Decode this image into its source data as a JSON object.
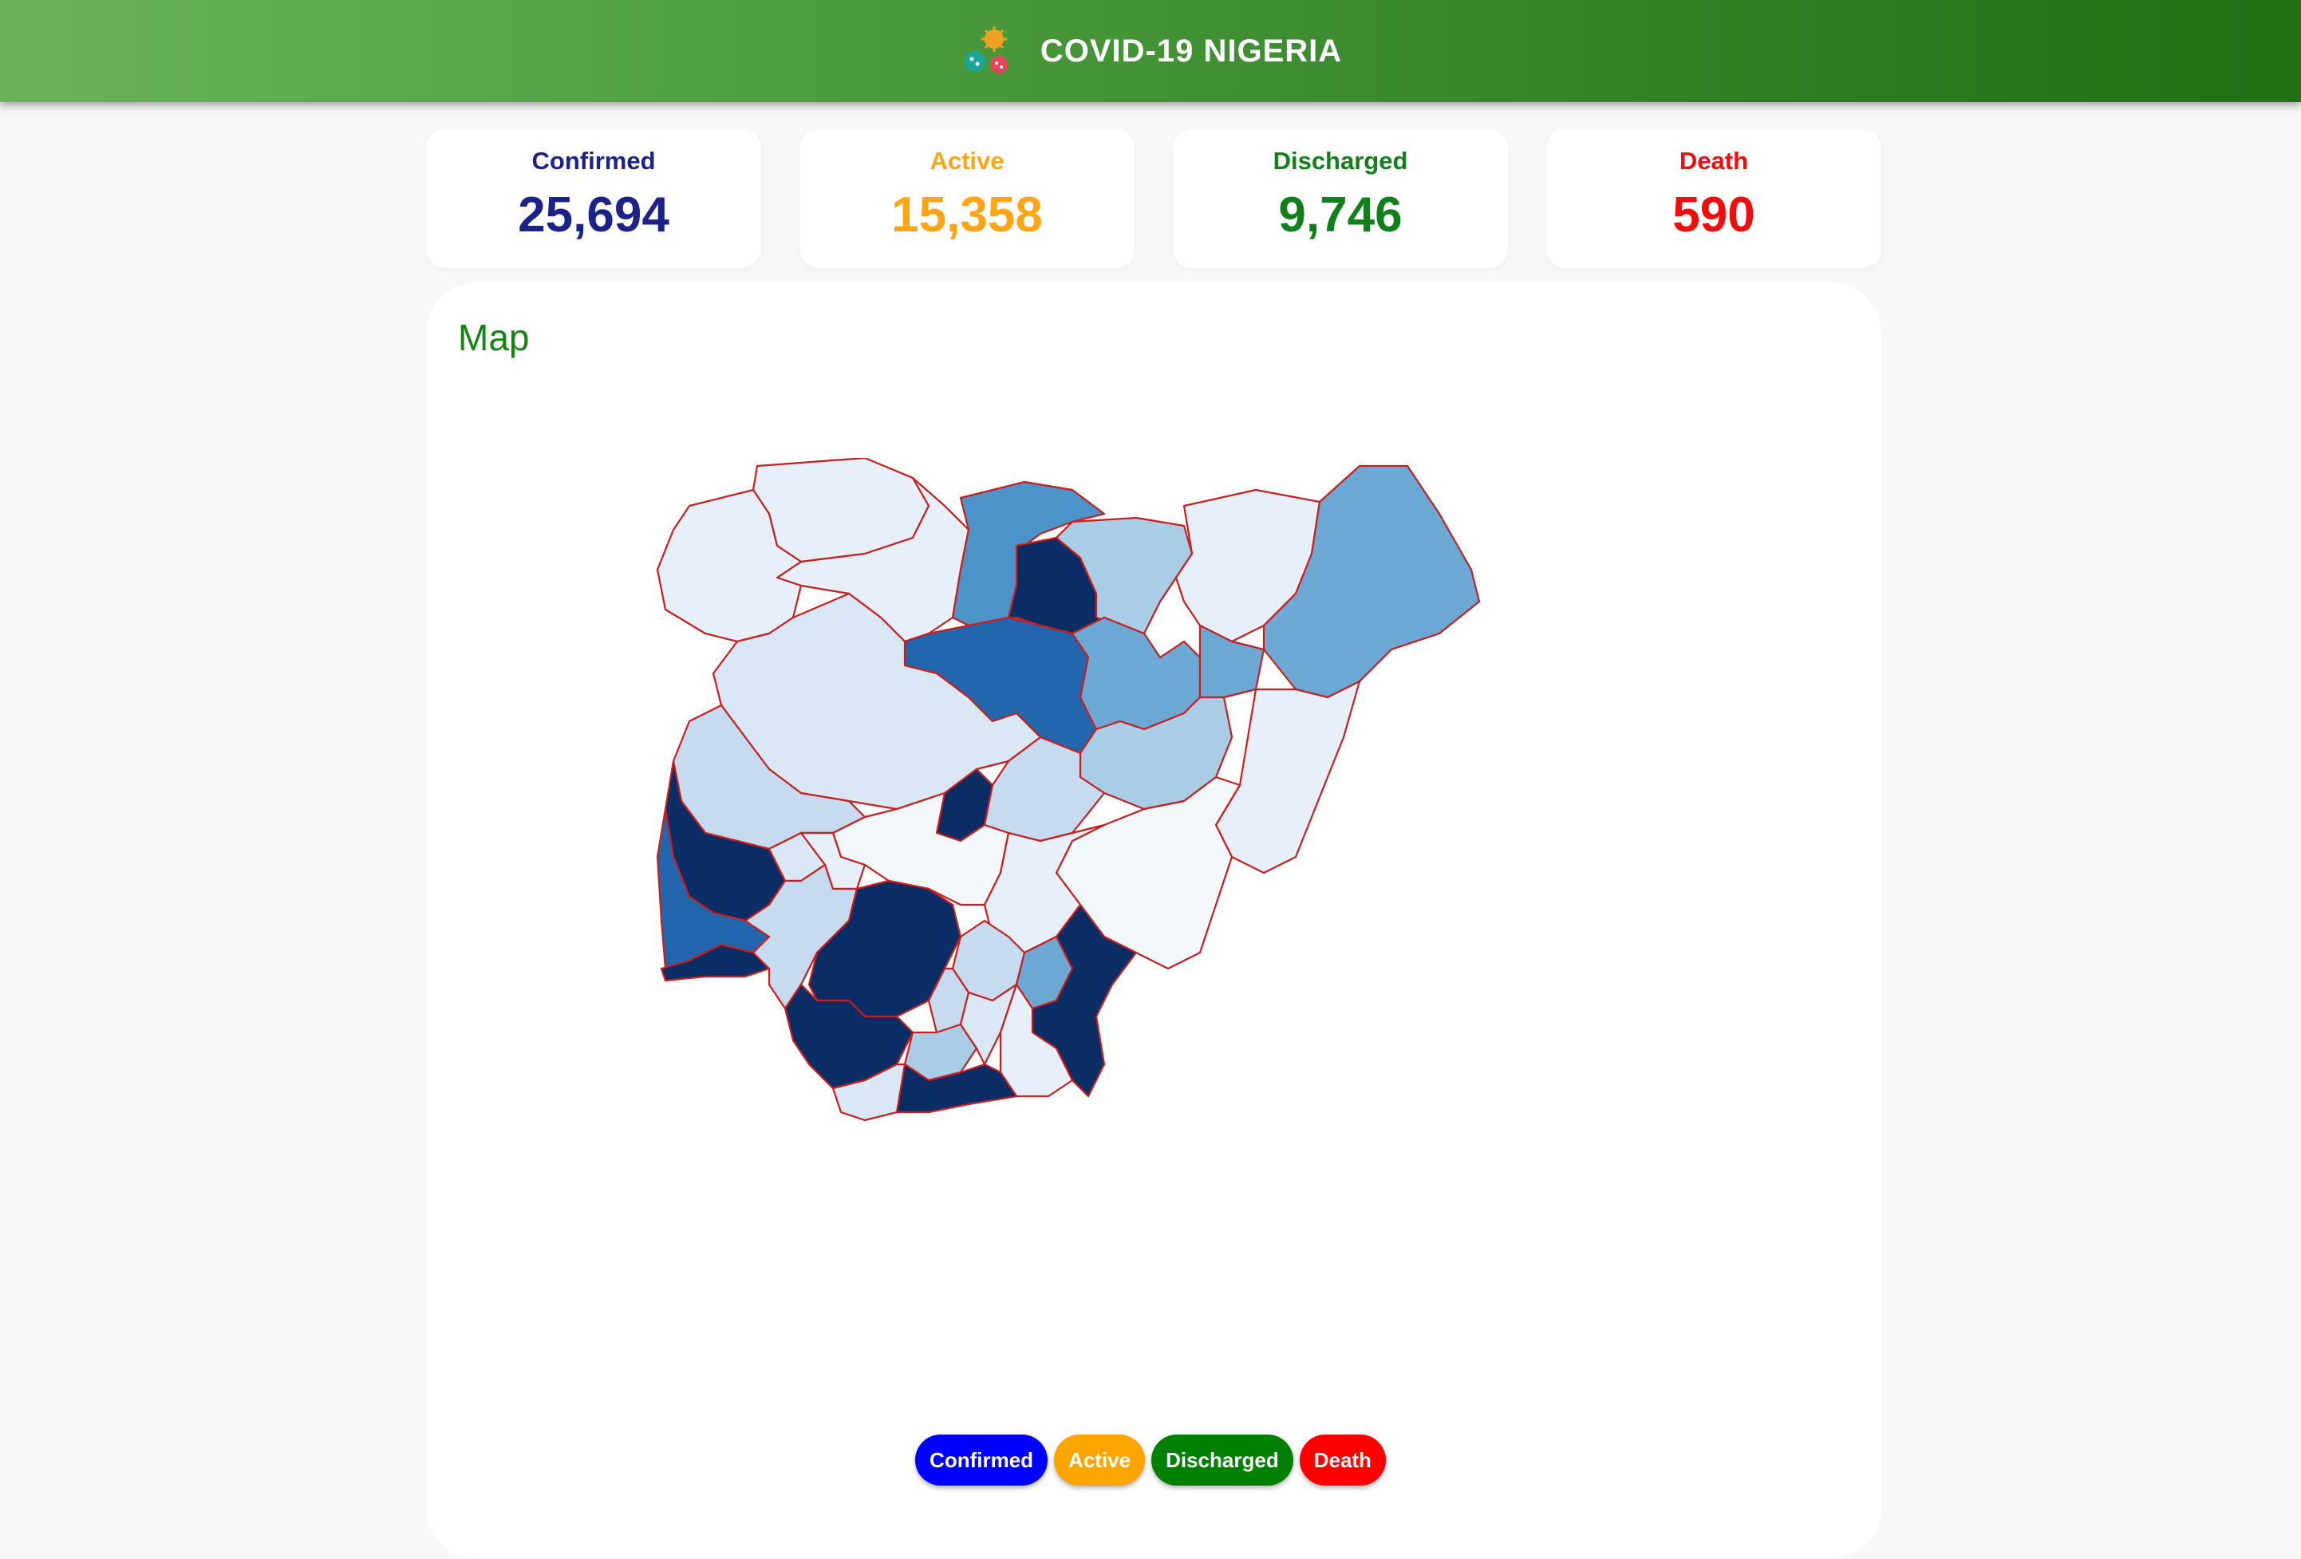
{
  "header": {
    "title": "COVID-19 NIGERIA",
    "logo_icon": "virus-icon"
  },
  "stats": [
    {
      "label": "Confirmed",
      "value": "25,694",
      "color": "#1c2288"
    },
    {
      "label": "Active",
      "value": "15,358",
      "color": "#ffa516"
    },
    {
      "label": "Discharged",
      "value": "9,746",
      "color": "#12801a"
    },
    {
      "label": "Death",
      "value": "590",
      "color": "#f20d0d"
    }
  ],
  "map": {
    "title": "Map",
    "border_color": "#c81e1e",
    "scale_colors": [
      "#f3f8fd",
      "#e7f0fa",
      "#dae7f5",
      "#c6dbef",
      "#a9cde4",
      "#6ba9d4",
      "#4b93c8",
      "#2266ad",
      "#0b2d66"
    ]
  },
  "legend": [
    {
      "label": "Confirmed",
      "color": "#0000ff"
    },
    {
      "label": "Active",
      "color": "#ffa500"
    },
    {
      "label": "Discharged",
      "color": "#008000"
    },
    {
      "label": "Death",
      "color": "#ff0000"
    }
  ]
}
